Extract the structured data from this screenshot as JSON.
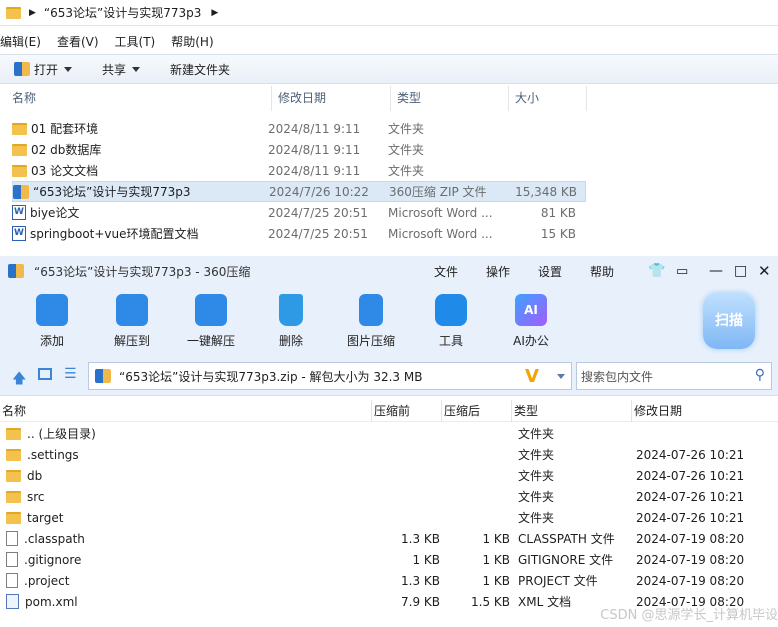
{
  "explorer": {
    "path_label": "“653论坛”设计与实现773p3",
    "menu": [
      "编辑(E)",
      "查看(V)",
      "工具(T)",
      "帮助(H)"
    ],
    "toolbar": {
      "open": "打开",
      "share": "共享",
      "new_folder": "新建文件夹"
    },
    "columns": {
      "name": "名称",
      "date": "修改日期",
      "type": "类型",
      "size": "大小"
    },
    "rows": [
      {
        "name": "01 配套环境",
        "date": "2024/8/11 9:11",
        "type": "文件夹",
        "size": "",
        "icon": "folder-icon"
      },
      {
        "name": "02 db数据库",
        "date": "2024/8/11 9:11",
        "type": "文件夹",
        "size": "",
        "icon": "folder-icon"
      },
      {
        "name": "03 论文文档",
        "date": "2024/8/11 9:11",
        "type": "文件夹",
        "size": "",
        "icon": "folder-icon"
      },
      {
        "name": "“653论坛”设计与实现773p3",
        "date": "2024/7/26 10:22",
        "type": "360压缩 ZIP 文件",
        "size": "15,348 KB",
        "icon": "zip-icon"
      },
      {
        "name": "biye论文",
        "date": "2024/7/25 20:51",
        "type": "Microsoft Word ...",
        "size": "81 KB",
        "icon": "word-icon"
      },
      {
        "name": "springboot+vue环境配置文档",
        "date": "2024/7/25 20:51",
        "type": "Microsoft Word ...",
        "size": "15 KB",
        "icon": "word-icon"
      }
    ]
  },
  "zip": {
    "title": "“653论坛”设计与实现773p3 - 360压缩",
    "menu": [
      "文件",
      "操作",
      "设置",
      "帮助"
    ],
    "tools": [
      "添加",
      "解压到",
      "一键解压",
      "删除",
      "图片压缩",
      "工具",
      "AI办公"
    ],
    "scan_label": "扫描",
    "address": "“653论坛”设计与实现773p3.zip - 解包大小为 32.3 MB",
    "search_placeholder": "搜索包内文件",
    "columns": {
      "name": "名称",
      "compressed_before": "压缩前",
      "compressed_after": "压缩后",
      "type": "类型",
      "date": "修改日期"
    },
    "rows": [
      {
        "name": ".. (上级目录)",
        "before": "",
        "after": "",
        "type": "文件夹",
        "date": "",
        "icon": "folder-icon"
      },
      {
        "name": ".settings",
        "before": "",
        "after": "",
        "type": "文件夹",
        "date": "2024-07-26 10:21",
        "icon": "folder-icon"
      },
      {
        "name": "db",
        "before": "",
        "after": "",
        "type": "文件夹",
        "date": "2024-07-26 10:21",
        "icon": "folder-icon"
      },
      {
        "name": "src",
        "before": "",
        "after": "",
        "type": "文件夹",
        "date": "2024-07-26 10:21",
        "icon": "folder-icon"
      },
      {
        "name": "target",
        "before": "",
        "after": "",
        "type": "文件夹",
        "date": "2024-07-26 10:21",
        "icon": "folder-icon"
      },
      {
        "name": ".classpath",
        "before": "1.3 KB",
        "after": "1 KB",
        "type": "CLASSPATH 文件",
        "date": "2024-07-19 08:20",
        "icon": "file-icon"
      },
      {
        "name": ".gitignore",
        "before": "1 KB",
        "after": "1 KB",
        "type": "GITIGNORE 文件",
        "date": "2024-07-19 08:20",
        "icon": "file-icon"
      },
      {
        "name": ".project",
        "before": "1.3 KB",
        "after": "1 KB",
        "type": "PROJECT 文件",
        "date": "2024-07-19 08:20",
        "icon": "file-icon"
      },
      {
        "name": "pom.xml",
        "before": "7.9 KB",
        "after": "1.5 KB",
        "type": "XML 文档",
        "date": "2024-07-19 08:20",
        "icon": "xml-icon"
      }
    ]
  },
  "watermark": "CSDN @思源学长_计算机毕设"
}
